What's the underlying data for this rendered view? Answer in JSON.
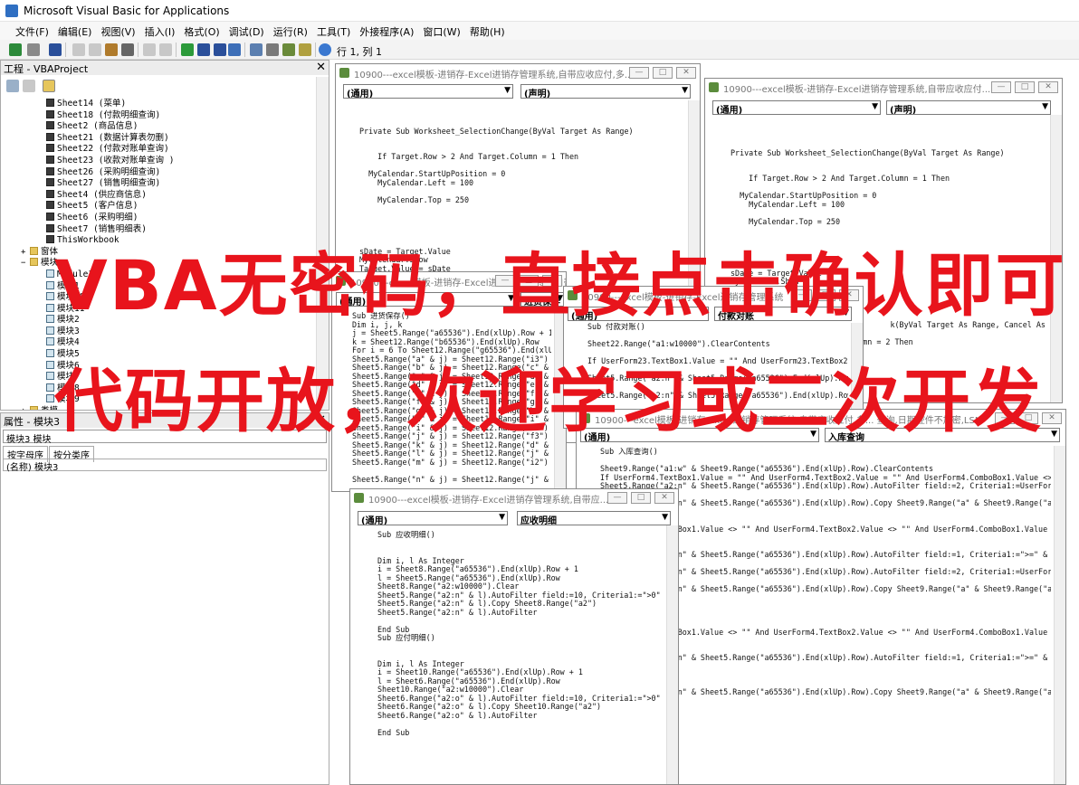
{
  "window": {
    "title": "Microsoft Visual Basic for Applications"
  },
  "menu": [
    "文件(F)",
    "编辑(E)",
    "视图(V)",
    "插入(I)",
    "格式(O)",
    "调试(D)",
    "运行(R)",
    "工具(T)",
    "外接程序(A)",
    "窗口(W)",
    "帮助(H)"
  ],
  "toolbar": {
    "position": "行 1, 列 1"
  },
  "project": {
    "title": "工程 - VBAProject",
    "items": [
      {
        "t": "Sheet14 (菜单)",
        "k": "sheet",
        "l": 1
      },
      {
        "t": "Sheet18 (付款明细查询)",
        "k": "sheet",
        "l": 1
      },
      {
        "t": "Sheet2 (商品信息)",
        "k": "sheet",
        "l": 1
      },
      {
        "t": "Sheet21 (数据计算表勿删)",
        "k": "sheet",
        "l": 1
      },
      {
        "t": "Sheet22 (付款对账单查询)",
        "k": "sheet",
        "l": 1
      },
      {
        "t": "Sheet23 (收款对账单查询 )",
        "k": "sheet",
        "l": 1
      },
      {
        "t": "Sheet26 (采购明细查询)",
        "k": "sheet",
        "l": 1
      },
      {
        "t": "Sheet27 (销售明细查询)",
        "k": "sheet",
        "l": 1
      },
      {
        "t": "Sheet4 (供应商信息)",
        "k": "sheet",
        "l": 1
      },
      {
        "t": "Sheet5 (客户信息)",
        "k": "sheet",
        "l": 1
      },
      {
        "t": "Sheet6 (采购明细)",
        "k": "sheet",
        "l": 1
      },
      {
        "t": "Sheet7 (销售明细表)",
        "k": "sheet",
        "l": 1
      },
      {
        "t": "ThisWorkbook",
        "k": "sheet",
        "l": 1
      },
      {
        "t": "窗体",
        "k": "folder",
        "l": 0,
        "e": "+"
      },
      {
        "t": "模块",
        "k": "folder",
        "l": 0,
        "e": "−"
      },
      {
        "t": "Module1",
        "k": "mod",
        "l": 1
      },
      {
        "t": "模块1",
        "k": "mod",
        "l": 1
      },
      {
        "t": "模块10",
        "k": "mod",
        "l": 1
      },
      {
        "t": "模块11",
        "k": "mod",
        "l": 1
      },
      {
        "t": "模块2",
        "k": "mod",
        "l": 1
      },
      {
        "t": "模块3",
        "k": "mod",
        "l": 1
      },
      {
        "t": "模块4",
        "k": "mod",
        "l": 1
      },
      {
        "t": "模块5",
        "k": "mod",
        "l": 1
      },
      {
        "t": "模块6",
        "k": "mod",
        "l": 1
      },
      {
        "t": "模块7",
        "k": "mod",
        "l": 1
      },
      {
        "t": "模块8",
        "k": "mod",
        "l": 1
      },
      {
        "t": "模块9",
        "k": "mod",
        "l": 1
      },
      {
        "t": "类模",
        "k": "folder",
        "l": 0,
        "e": "+"
      }
    ]
  },
  "properties": {
    "title": "属性 - 模块3",
    "object": "模块3 模块",
    "tabs": [
      "按字母序",
      "按分类序"
    ],
    "name_label": "(名称)",
    "name_value": "模块3"
  },
  "windows": [
    {
      "title": "10900---excel模板-进销存-Excel进销存管理系统,自带应收应付,多...",
      "left": "(通用)",
      "right": "(声明)",
      "code": "\nPrivate Sub Worksheet_SelectionChange(ByVal Target As Range)\n\n\n    If Target.Row > 2 And Target.Column = 1 Then\n\n  MyCalendar.StartUpPosition = 0\n    MyCalendar.Left = 100\n\n    MyCalendar.Top = 250\n\n\n\n\n\nsDate = Target.Value\nMyCalendar.Show\nTarget.Value = sDate\n    End If"
    },
    {
      "title": "10900---excel模板-进销存-Excel进销存管理系统,自带应收应付...",
      "left": "(通用)",
      "right": "(声明)",
      "code": "\nPrivate Sub Worksheet_SelectionChange(ByVal Target As Range)\n\n\n    If Target.Row > 2 And Target.Column = 1 Then\n\n  MyCalendar.StartUpPosition = 0\n    MyCalendar.Left = 100\n\n    MyCalendar.Top = 250\n\n\n\n\n\nsDate = Target.Value\nMyCalendar.Show\nTarget.Value = sDate\n\n\n\n                                   k(ByVal Target As Range, Cancel As I\n\n                            umn = 2 Then\n                            0"
    },
    {
      "title": "10900---excel模板-进销存-Excel进销存管理系统,自带应收应付",
      "left": "(通用)",
      "right": "进货保存",
      "code": "Sub 进货保存()\nDim i, j, k\nj = Sheet5.Range(\"a65536\").End(xlUp).Row + 1\nk = Sheet12.Range(\"b65536\").End(xlUp).Row\nFor i = 6 To Sheet12.Range(\"g65536\").End(xlUp).Row\nSheet5.Range(\"a\" & j) = Sheet12.Range(\"i3\")\nSheet5.Range(\"b\" & j) = Sheet12.Range(\"c\" & i)\nSheet5.Range(\"c\" & j) = Sheet12.Range(\"d\" & i)\nSheet5.Range(\"d\" & j) = Sheet12.Range(\"e\" & i)\nSheet5.Range(\"e\" & j) = Sheet12.Range(\"f\" & i)\nSheet5.Range(\"f\" & j) = Sheet12.Range(\"g\" & i)\nSheet5.Range(\"g\" & j) = Sheet12.Range(\"h\" & i)\nSheet5.Range(\"h\" & j) = Sheet12.Range(\"i\" & i)\nSheet5.Range(\"i\" & j) = Sheet12.Range(\"c3\")\nSheet5.Range(\"j\" & j) = Sheet12.Range(\"f3\")\nSheet5.Range(\"k\" & j) = Sheet12.Range(\"d\" & k)\nSheet5.Range(\"l\" & j) = Sheet12.Range(\"j\" & k)\nSheet5.Range(\"m\" & j) = Sheet12.Range(\"i2\")\n\nSheet5.Range(\"n\" & j) = Sheet12.Range(\"j\" & i)"
    },
    {
      "title": "10900---excel模板-进销存-Excel进销存管理系统",
      "left": "(通用)",
      "right": "付款对账",
      "code": "Sub 付款对账()\n\nSheet22.Range(\"a1:w10000\").ClearContents\n\nIf UserForm23.TextBox1.Value = \"\" And UserForm23.TextBox2.Va\n\nSheet5.Range(\"a2:n\" & Sheet5.Range(\"a65536\").End(xlUp).Row\n\nSheet5.Range(\"a2:n\" & Sheet5.Range(\"a65536\").End(xlUp).Row)"
    },
    {
      "title": "10900---excel模板-进销存-Excel进销存管理系统,自带应收应付,多... 查询,日期控件不加密,LSM",
      "left": "(通用)",
      "right": "入库查询",
      "code": "Sub 入库查询()\n\nSheet9.Range(\"a1:w\" & Sheet9.Range(\"a65536\").End(xlUp).Row).ClearContents\nIf UserForm4.TextBox1.Value = \"\" And UserForm4.TextBox2.Value = \"\" And UserForm4.ComboBox1.Value <> \"\" The\nSheet5.Range(\"a2:n\" & Sheet5.Range(\"a65536\").End(xlUp).Row).AutoFilter field:=2, Criteria1:=UserForm4.Comb\n\nSheet5.Range(\"a2:n\" & Sheet5.Range(\"a65536\").End(xlUp).Row).Copy Sheet9.Range(\"a\" & Sheet9.Range(\"a65536\")\n\n\nIf UserForm4.TextBox1.Value <> \"\" And UserForm4.TextBox2.Value <> \"\" And UserForm4.ComboBox1.Value <>\n\n\nSheet5.Range(\"a2:n\" & Sheet5.Range(\"a65536\").End(xlUp).Row).AutoFilter field:=1, Criteria1:=\">=\" & UserFor\n\nSheet5.Range(\"a2:n\" & Sheet5.Range(\"a65536\").End(xlUp).Row).AutoFilter field:=2, Criteria1:=UserForm4.Comb\n\nSheet5.Range(\"a2:n\" & Sheet5.Range(\"a65536\").End(xlUp).Row).Copy Sheet9.Range(\"a\" & Sheet9.Range(\"a65536\")\n\n\n\n\nIf UserForm4.TextBox1.Value <> \"\" And UserForm4.TextBox2.Value <> \"\" And UserForm4.ComboBox1.Value = \"\n\n\nSheet5.Range(\"a2:n\" & Sheet5.Range(\"a65536\").End(xlUp).Row).AutoFilter field:=1, Criteria1:=\">=\" & UserFor\n\n\n\nSheet5.Range(\"a2:n\" & Sheet5.Range(\"a65536\").End(xlUp).Row).Copy Sheet9.Range(\"a\" & Sheet9.Range(\"a65536\")\n\n\n\n\n\n息\""
    },
    {
      "title": "10900---excel模板-进销存-Excel进销存管理系统,自带应...",
      "left": "(通用)",
      "right": "应收明细",
      "code": "Sub 应收明细()\n\n\nDim i, l As Integer\ni = Sheet8.Range(\"a65536\").End(xlUp).Row + 1\nl = Sheet5.Range(\"a65536\").End(xlUp).Row\nSheet8.Range(\"a2:w10000\").Clear\nSheet5.Range(\"a2:n\" & l).AutoFilter field:=10, Criteria1:=\">0\"\nSheet5.Range(\"a2:n\" & l).Copy Sheet8.Range(\"a2\")\nSheet5.Range(\"a2:n\" & l).AutoFilter\n\nEnd Sub\nSub 应付明细()\n\n\nDim i, l As Integer\ni = Sheet10.Range(\"a65536\").End(xlUp).Row + 1\nl = Sheet6.Range(\"a65536\").End(xlUp).Row\nSheet10.Range(\"a2:w10000\").Clear\nSheet6.Range(\"a2:o\" & l).AutoFilter field:=10, Criteria1:=\">0\"\nSheet6.Range(\"a2:o\" & l).Copy Sheet10.Range(\"a2\")\nSheet6.Range(\"a2:o\" & l).AutoFilter\n\nEnd Sub"
    }
  ],
  "overlay": {
    "line1": "VBA无密码，直接点击确认即可",
    "line2": "代码开放，欢迎学习或二次开发"
  },
  "colors": {
    "overlay": "#e8141c",
    "window_icon": "#5b8c3c"
  }
}
